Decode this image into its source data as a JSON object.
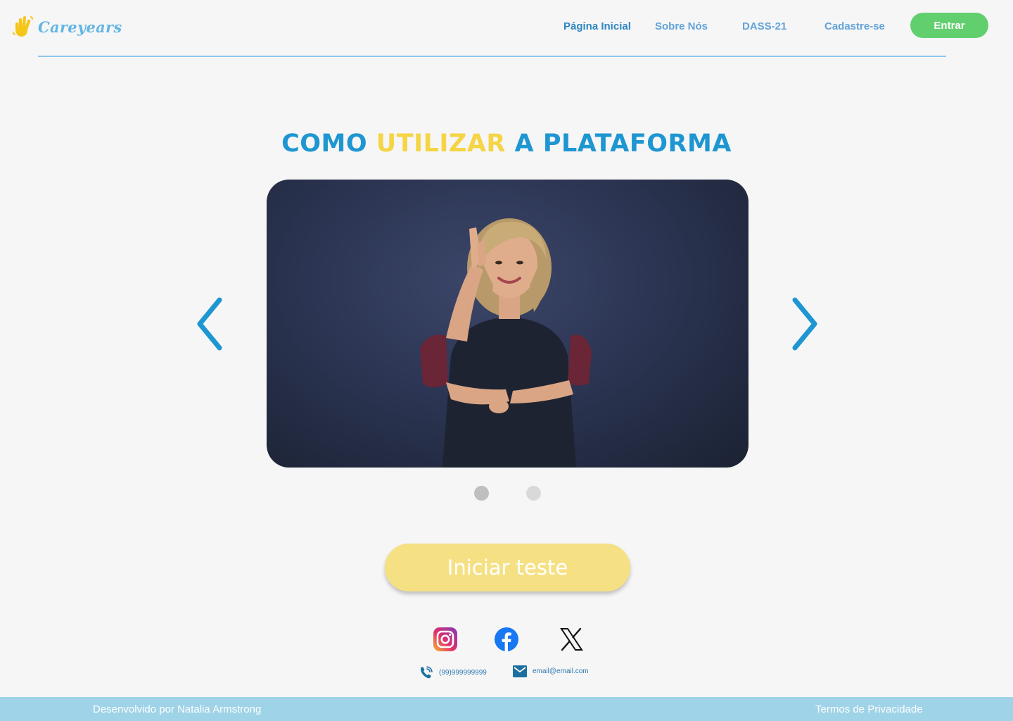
{
  "header": {
    "brand": "Careyears",
    "nav": [
      {
        "label": "Página Inicial",
        "active": true
      },
      {
        "label": "Sobre Nós",
        "active": false
      },
      {
        "label": "DASS-21",
        "active": false
      },
      {
        "label": "Cadastre-se",
        "active": false
      }
    ],
    "login_label": "Entrar"
  },
  "hero": {
    "title_part1": "COMO",
    "title_part2": "UTILIZAR",
    "title_part3": "A PLATAFORMA",
    "carousel": {
      "slides": 2,
      "active_slide": 1
    },
    "cta_label": "Iniciar teste"
  },
  "social": {
    "links": [
      "instagram",
      "facebook",
      "x"
    ],
    "phone": "(99)999999999",
    "email": "email@email.com"
  },
  "footer": {
    "credit": "Desenvolvido por Natalia Armstrong",
    "privacy": "Termos de Privacidade"
  },
  "colors": {
    "brand_blue": "#1e96d1",
    "brand_yellow": "#f5d445",
    "login_green": "#62cf6f",
    "cta_yellow": "#f5e184",
    "footer_bg": "#9fd3e8"
  }
}
